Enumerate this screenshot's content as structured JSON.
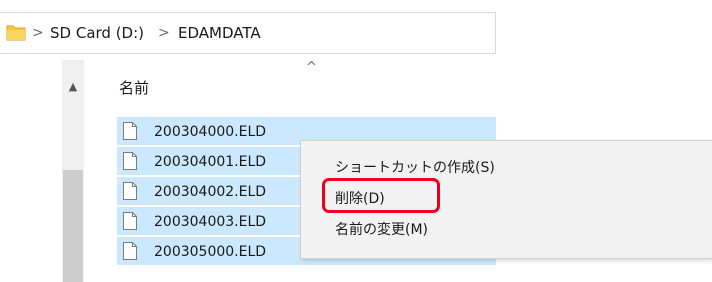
{
  "address_bar": {
    "crumbs": [
      "SD Card (D:)",
      "EDAMDATA"
    ],
    "separator": ">"
  },
  "file_list": {
    "column_header": "名前",
    "files": [
      "200304000.ELD",
      "200304001.ELD",
      "200304002.ELD",
      "200304003.ELD",
      "200305000.ELD"
    ]
  },
  "context_menu": {
    "items": [
      "ショートカットの作成(S)",
      "削除(D)",
      "名前の変更(M)"
    ]
  },
  "colors": {
    "selection": "#cce8ff",
    "menu_background": "#f2f2f2",
    "highlight_outline": "#e8001c",
    "folder_yellow": "#f8c83c"
  },
  "icons": [
    "folder-icon",
    "chevron-right-icon",
    "chevron-up-icon",
    "document-icon"
  ]
}
